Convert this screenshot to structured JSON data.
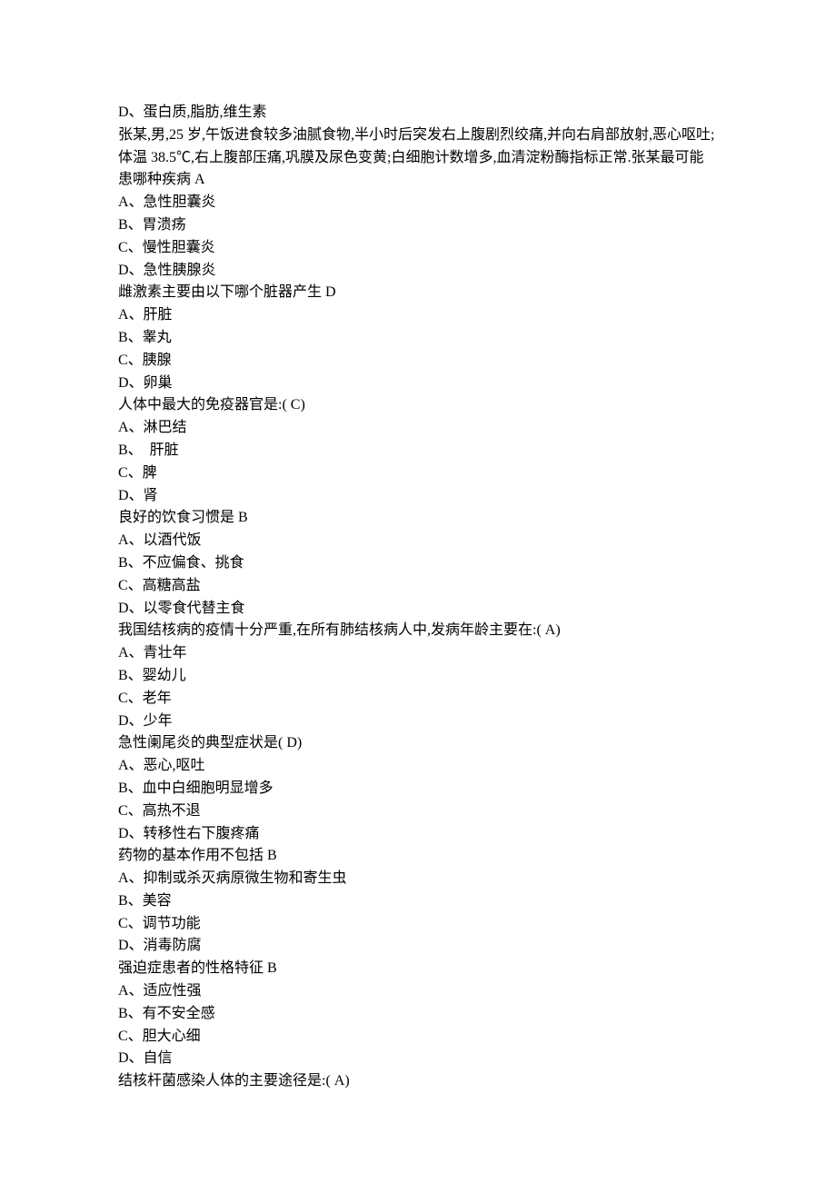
{
  "lines": [
    "D、蛋白质,脂肪,维生素",
    "张某,男,25 岁,午饭进食较多油腻食物,半小时后突发右上腹剧烈绞痛,并向右肩部放射,恶心呕吐;体温 38.5℃,右上腹部压痛,巩膜及尿色变黄;白细胞计数增多,血清淀粉酶指标正常.张某最可能患哪种疾病 A",
    "A、急性胆囊炎",
    "B、胃溃疡",
    "C、慢性胆囊炎",
    "D、急性胰腺炎",
    "雌激素主要由以下哪个脏器产生 D",
    "A、肝脏",
    "B、睾丸",
    "C、胰腺",
    "D、卵巢",
    "人体中最大的免疫器官是:( C)",
    "A、淋巴结",
    "B、  肝脏",
    "C、脾",
    "D、肾",
    "良好的饮食习惯是 B",
    "A、以酒代饭",
    "B、不应偏食、挑食",
    "C、高糖高盐",
    "D、以零食代替主食",
    "我国结核病的疫情十分严重,在所有肺结核病人中,发病年龄主要在:( A)",
    "A、青壮年",
    "B、婴幼儿",
    "C、老年",
    "D、少年",
    "急性阑尾炎的典型症状是( D)",
    "A、恶心,呕吐",
    "B、血中白细胞明显增多",
    "C、高热不退",
    "D、转移性右下腹疼痛",
    "药物的基本作用不包括 B",
    "A、抑制或杀灭病原微生物和寄生虫",
    "B、美容",
    "C、调节功能",
    "D、消毒防腐",
    "强迫症患者的性格特征 B",
    "A、适应性强",
    "B、有不安全感",
    "C、胆大心细",
    "D、自信",
    "结核杆菌感染人体的主要途径是:( A)"
  ]
}
